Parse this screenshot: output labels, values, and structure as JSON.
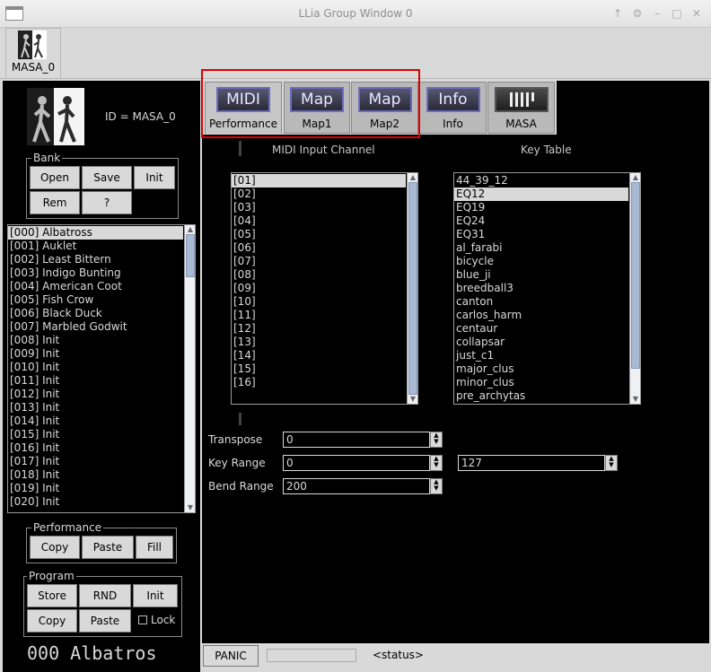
{
  "window": {
    "title": "LLia Group Window 0"
  },
  "group_tab": {
    "label": "MASA_0"
  },
  "synth": {
    "id_text": "ID = MASA_0"
  },
  "bank": {
    "title": "Bank",
    "buttons": [
      "Open",
      "Save",
      "Init",
      "Rem",
      "?"
    ]
  },
  "programs": [
    "[000] Albatross",
    "[001] Auklet",
    "[002] Least Bittern",
    "[003] Indigo Bunting",
    "[004] American Coot",
    "[005] Fish Crow",
    "[006] Black Duck",
    "[007] Marbled Godwit",
    "[008] Init",
    "[009] Init",
    "[010] Init",
    "[011] Init",
    "[012] Init",
    "[013] Init",
    "[014] Init",
    "[015] Init",
    "[016] Init",
    "[017] Init",
    "[018] Init",
    "[019] Init",
    "[020] Init"
  ],
  "performance": {
    "title": "Performance",
    "buttons": [
      "Copy",
      "Paste",
      "Fill"
    ]
  },
  "program": {
    "title": "Program",
    "buttons": [
      "Store",
      "RND",
      "Init",
      "Copy",
      "Paste"
    ],
    "lock_label": "Lock"
  },
  "current_program": "000 Albatros",
  "tabs": [
    {
      "icon": "MIDI",
      "label": "Performance"
    },
    {
      "icon": "Map",
      "label": "Map1"
    },
    {
      "icon": "Map",
      "label": "Map2"
    },
    {
      "icon": "Info",
      "label": "Info"
    },
    {
      "icon": "",
      "label": "MASA"
    }
  ],
  "midi_channel": {
    "header": "MIDI Input Channel",
    "items": [
      "[01]",
      "[02]",
      "[03]",
      "[04]",
      "[05]",
      "[06]",
      "[07]",
      "[08]",
      "[09]",
      "[10]",
      "[11]",
      "[12]",
      "[13]",
      "[14]",
      "[15]",
      "[16]"
    ],
    "selected": 0
  },
  "key_table": {
    "header": "Key Table",
    "items": [
      "44_39_12",
      "EQ12",
      "EQ19",
      "EQ24",
      "EQ31",
      "al_farabi",
      "bicycle",
      "blue_ji",
      "breedball3",
      "canton",
      "carlos_harm",
      "centaur",
      "collapsar",
      "just_c1",
      "major_clus",
      "minor_clus",
      "pre_archytas"
    ],
    "selected": 1
  },
  "fields": {
    "transpose": {
      "label": "Transpose",
      "value": "0"
    },
    "key_range": {
      "label": "Key Range",
      "low": "0",
      "high": "127"
    },
    "bend_range": {
      "label": "Bend Range",
      "value": "200"
    }
  },
  "footer": {
    "panic_label": "PANIC",
    "status": "<status>"
  },
  "colors": {
    "highlight_border": "#e00000"
  }
}
